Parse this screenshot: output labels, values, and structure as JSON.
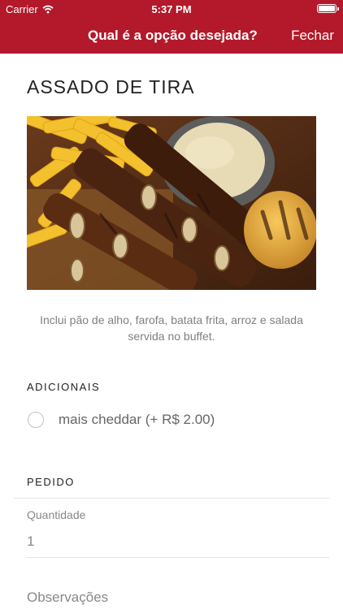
{
  "status_bar": {
    "carrier": "Carrier",
    "time": "5:37 PM"
  },
  "nav": {
    "title": "Qual é a opção desejada?",
    "close_label": "Fechar"
  },
  "item": {
    "title": "ASSADO DE TIRA",
    "description": "Inclui pão de alho, farofa, batata frita, arroz e salada servida no buffet."
  },
  "addons": {
    "section_label": "ADICIONAIS",
    "options": [
      {
        "label": "mais cheddar (+ R$ 2.00)",
        "selected": false
      }
    ]
  },
  "order": {
    "section_label": "PEDIDO",
    "quantity_label": "Quantidade",
    "quantity_value": "1",
    "notes_placeholder": "Observações"
  },
  "colors": {
    "accent": "#b3192a"
  }
}
